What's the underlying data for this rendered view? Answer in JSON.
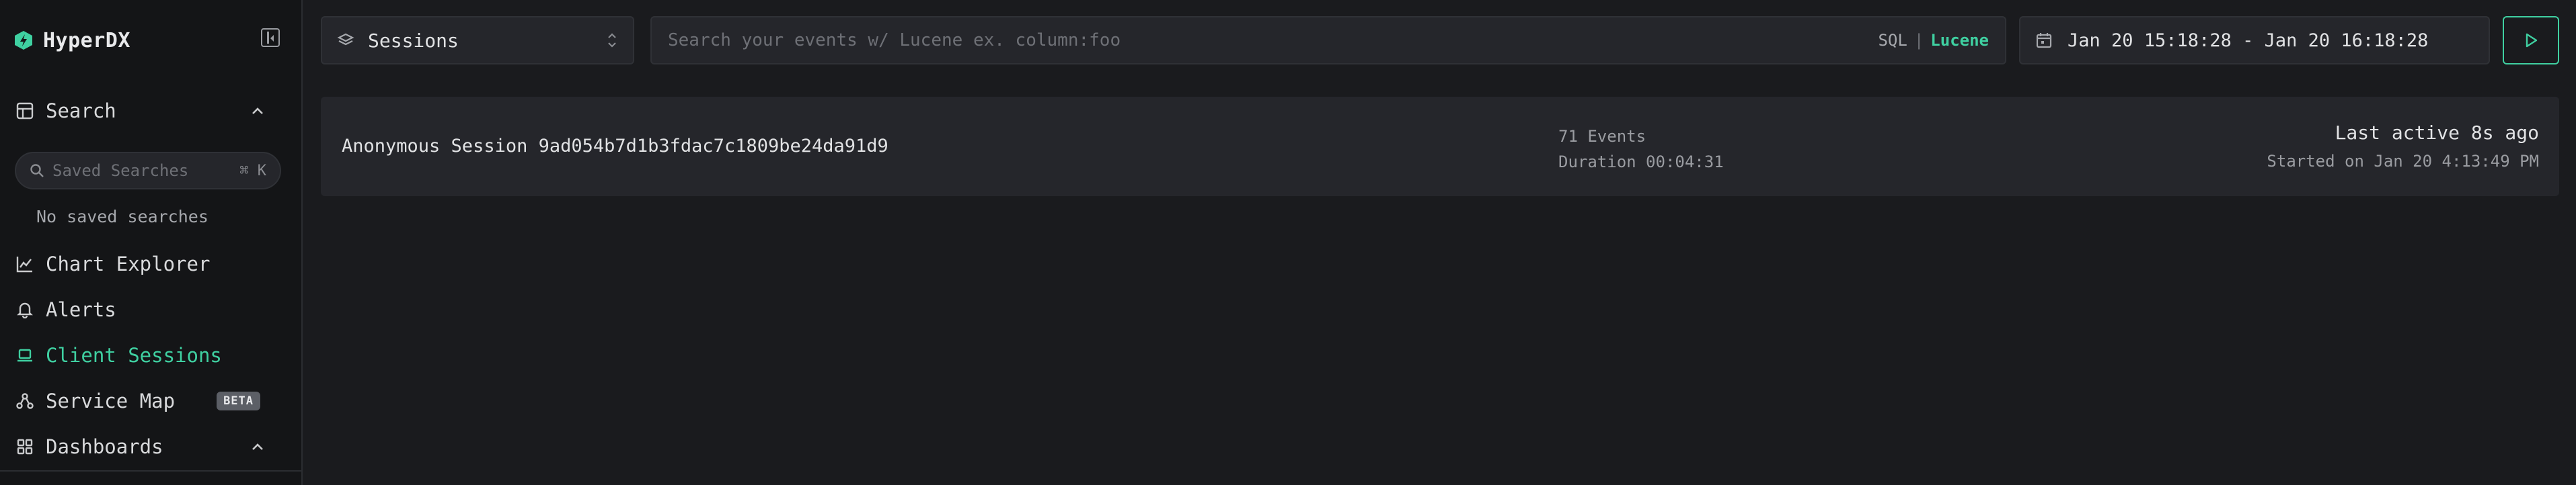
{
  "app": {
    "name": "HyperDX"
  },
  "sidebar": {
    "search": {
      "label": "Search"
    },
    "saved_search": {
      "placeholder": "Saved Searches",
      "shortcut": "⌘ K"
    },
    "no_saved": "No saved searches",
    "items": [
      {
        "label": "Chart Explorer"
      },
      {
        "label": "Alerts"
      },
      {
        "label": "Client Sessions",
        "active": true
      },
      {
        "label": "Service Map",
        "badge": "BETA"
      },
      {
        "label": "Dashboards"
      }
    ]
  },
  "topbar": {
    "source": {
      "value": "Sessions"
    },
    "search": {
      "placeholder": "Search your events w/ Lucene ex. column:foo",
      "value": "",
      "modes": [
        "SQL",
        "Lucene"
      ],
      "active_mode": "Lucene",
      "separator": "|"
    },
    "time_range": {
      "value": "Jan 20 15:18:28 - Jan 20 16:18:28"
    }
  },
  "sessions": [
    {
      "name": "Anonymous Session 9ad054b7d1b3fdac7c1809be24da91d9",
      "events": "71 Events",
      "duration": "Duration 00:04:31",
      "last_active": "Last active 8s ago",
      "started": "Started on Jan 20 4:13:49 PM"
    }
  ],
  "colors": {
    "accent": "#3fd0a1",
    "background": "#1a1b1e",
    "sidebar": "#141517",
    "panel": "#25262b"
  },
  "icons": {
    "logo": "hyperdx-logo-icon",
    "collapse": "sidebar-collapse-icon",
    "search_nav": "table-icon",
    "chevron": "chevron-up-icon",
    "search_field": "search-icon",
    "chart": "chart-line-icon",
    "alerts": "bell-icon",
    "sessions": "laptop-icon",
    "service_map": "hierarchy-icon",
    "dashboards": "grid-icon",
    "source": "layers-icon",
    "selector": "selector-icon",
    "calendar": "calendar-icon",
    "run": "play-icon"
  }
}
